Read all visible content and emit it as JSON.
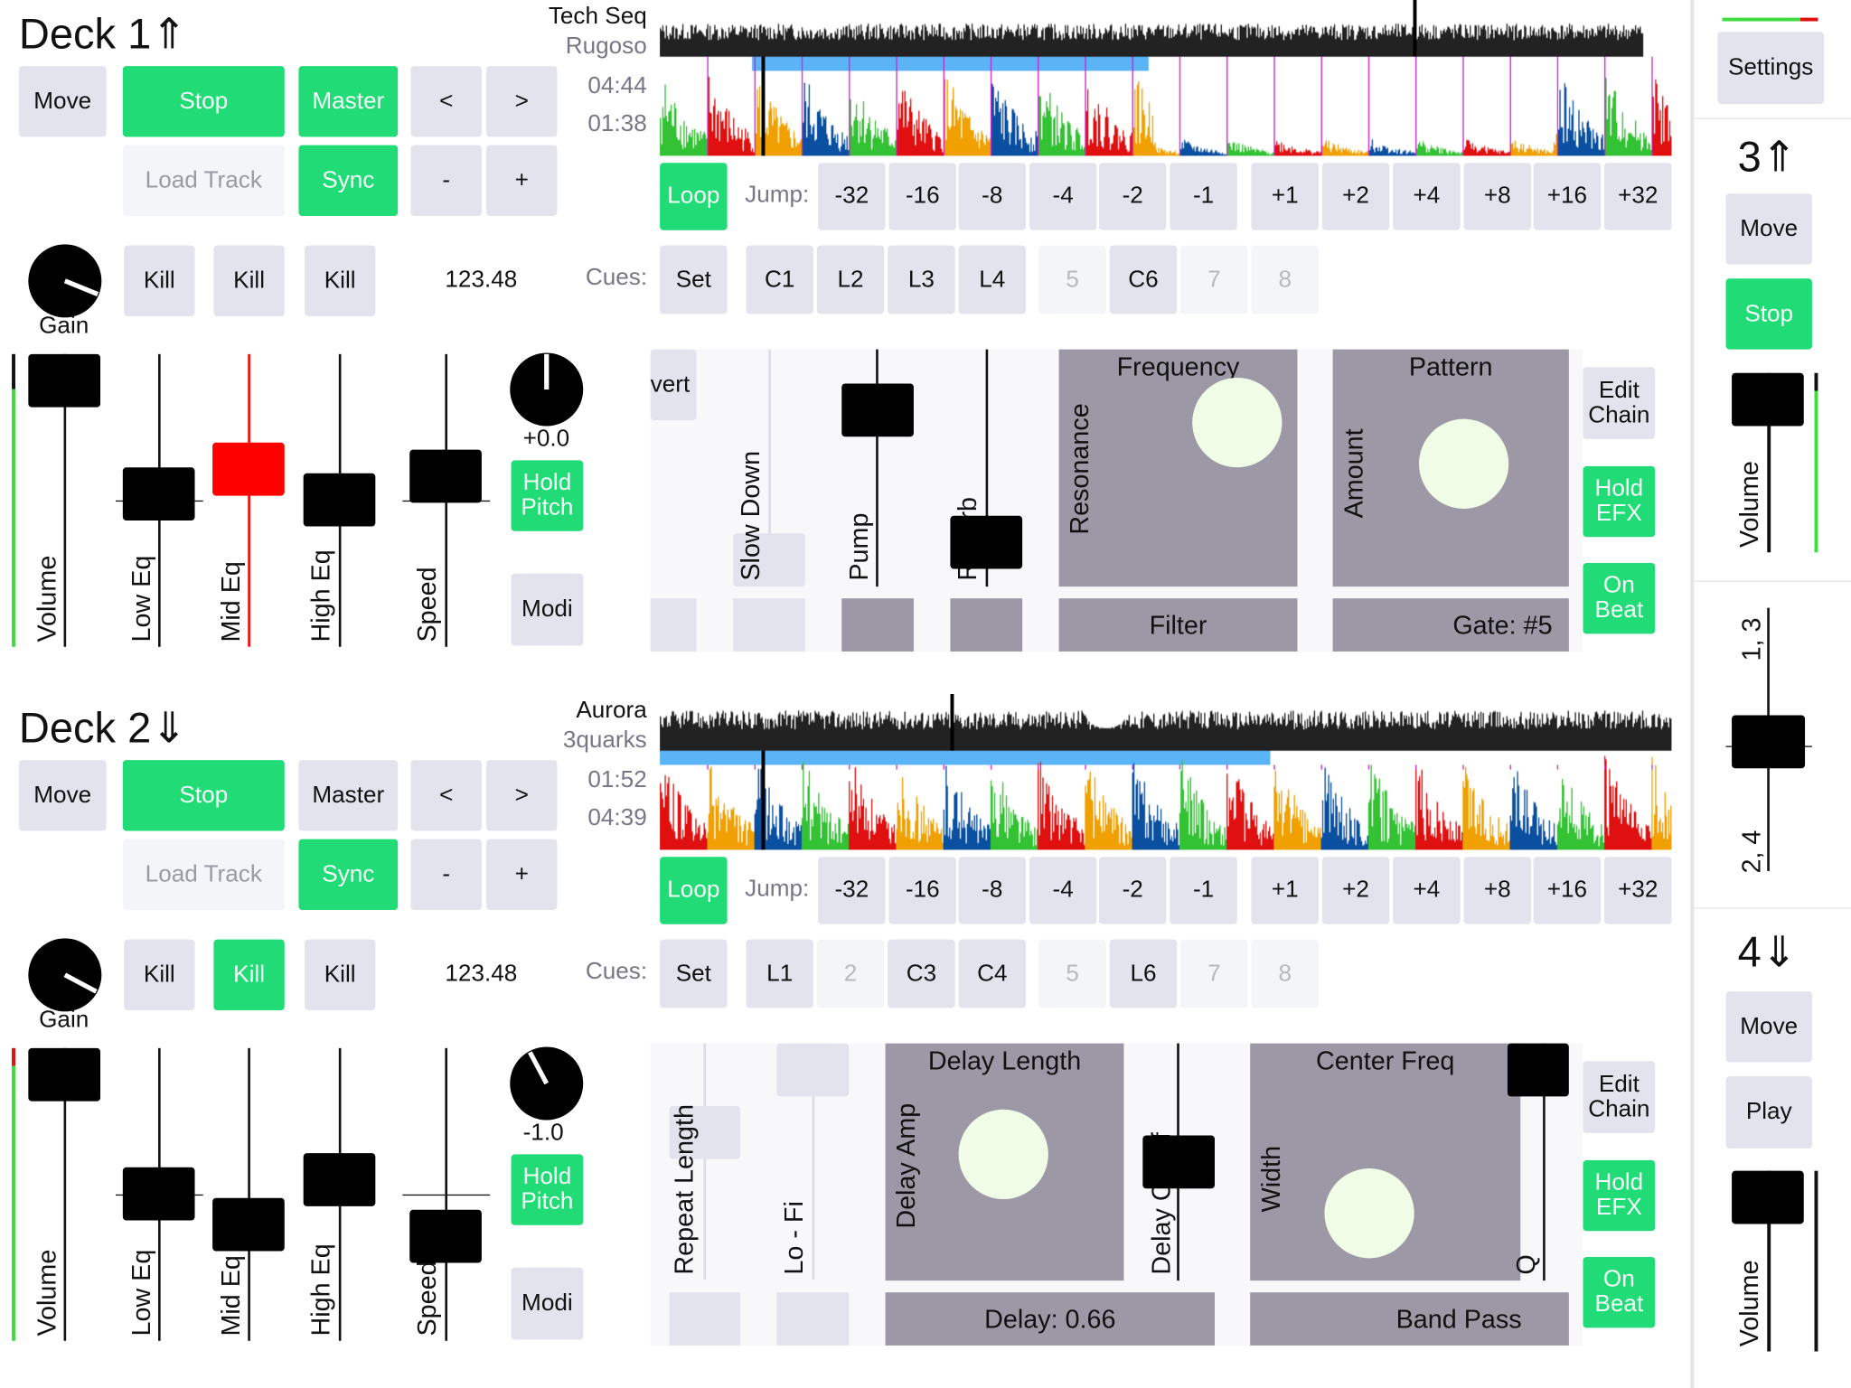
{
  "colors": {
    "accent_green": "#21dc76",
    "button": "#e3e3ee",
    "pad": "#9c98a6",
    "mid_eq_active": "#ff0000",
    "waveform": [
      "#33c233",
      "#e01010",
      "#f0a000",
      "#0a4fa0"
    ],
    "beat_marker": "#d020d0",
    "loop_region": "#5ab4f5"
  },
  "decks": [
    {
      "title": "Deck 1",
      "arrow": "⇑",
      "move": "Move",
      "stop": "Stop",
      "master": "Master",
      "master_active": true,
      "prev": "<",
      "next": ">",
      "load": "Load Track",
      "sync": "Sync",
      "minus": "-",
      "plus": "+",
      "track_title": "Tech Seq",
      "artist": "Rugoso",
      "time_total": "04:44",
      "time_left": "01:38",
      "loop": "Loop",
      "jump_label": "Jump:",
      "jumps": [
        "-32",
        "-16",
        "-8",
        "-4",
        "-2",
        "-1",
        "+1",
        "+2",
        "+4",
        "+8",
        "+16",
        "+32"
      ],
      "gain": "Gain",
      "kills": [
        {
          "label": "Kill",
          "active": false
        },
        {
          "label": "Kill",
          "active": false
        },
        {
          "label": "Kill",
          "active": false
        }
      ],
      "bpm": "123.48",
      "cues_label": "Cues:",
      "cues": [
        {
          "label": "Set",
          "enabled": true
        },
        {
          "label": "C1",
          "enabled": true
        },
        {
          "label": "L2",
          "enabled": true
        },
        {
          "label": "L3",
          "enabled": true
        },
        {
          "label": "L4",
          "enabled": true
        },
        {
          "label": "5",
          "enabled": false
        },
        {
          "label": "C6",
          "enabled": true
        },
        {
          "label": "7",
          "enabled": false
        },
        {
          "label": "8",
          "enabled": false
        }
      ],
      "sliders": {
        "volume": "Volume",
        "low_eq": "Low Eq",
        "mid_eq": "Mid Eq",
        "high_eq": "High Eq",
        "speed": "Speed"
      },
      "pitch_value": "+0.0",
      "hold_pitch": "Hold Pitch",
      "modi": "Modi",
      "fx": {
        "edit_chain": "Edit Chain",
        "hold_efx": "Hold EFX",
        "on_beat": "On Beat",
        "vert": "vert",
        "slow_down": "Slow Down",
        "pump": "Pump",
        "reverb": "Reverb",
        "pad1_x": "Frequency",
        "pad1_y": "Resonance",
        "pad1_button": "Filter",
        "pad2_x": "Pattern",
        "pad2_y": "Amount",
        "pad2_button": "Gate: #5"
      }
    },
    {
      "title": "Deck 2",
      "arrow": "⇓",
      "move": "Move",
      "stop": "Stop",
      "master": "Master",
      "master_active": false,
      "prev": "<",
      "next": ">",
      "load": "Load Track",
      "sync": "Sync",
      "minus": "-",
      "plus": "+",
      "track_title": "Aurora",
      "artist": "3quarks",
      "time_total": "01:52",
      "time_left": "04:39",
      "loop": "Loop",
      "jump_label": "Jump:",
      "jumps": [
        "-32",
        "-16",
        "-8",
        "-4",
        "-2",
        "-1",
        "+1",
        "+2",
        "+4",
        "+8",
        "+16",
        "+32"
      ],
      "gain": "Gain",
      "kills": [
        {
          "label": "Kill",
          "active": false
        },
        {
          "label": "Kill",
          "active": true
        },
        {
          "label": "Kill",
          "active": false
        }
      ],
      "bpm": "123.48",
      "cues_label": "Cues:",
      "cues": [
        {
          "label": "Set",
          "enabled": true
        },
        {
          "label": "L1",
          "enabled": true
        },
        {
          "label": "2",
          "enabled": false
        },
        {
          "label": "C3",
          "enabled": true
        },
        {
          "label": "C4",
          "enabled": true
        },
        {
          "label": "5",
          "enabled": false
        },
        {
          "label": "L6",
          "enabled": true
        },
        {
          "label": "7",
          "enabled": false
        },
        {
          "label": "8",
          "enabled": false
        }
      ],
      "sliders": {
        "volume": "Volume",
        "low_eq": "Low Eq",
        "mid_eq": "Mid Eq",
        "high_eq": "High Eq",
        "speed": "Speed"
      },
      "pitch_value": "-1.0",
      "hold_pitch": "Hold Pitch",
      "modi": "Modi",
      "fx": {
        "edit_chain": "Edit Chain",
        "hold_efx": "Hold EFX",
        "on_beat": "On Beat",
        "repeat_length": "Repeat Length",
        "lo_fi": "Lo - Fi",
        "delay_cutoff": "Delay Cutoff",
        "q": "Q",
        "pad1_x": "Delay Length",
        "pad1_y": "Delay Amp",
        "pad1_button": "Delay: 0.66",
        "pad2_x": "Center Freq",
        "pad2_y": "Width",
        "pad2_button": "Band Pass"
      }
    }
  ],
  "side": {
    "settings": "Settings",
    "deck3": {
      "title": "3",
      "arrow": "⇑",
      "move": "Move",
      "stop": "Stop",
      "volume": "Volume"
    },
    "crossfader": {
      "top": "1, 3",
      "bottom": "2, 4"
    },
    "deck4": {
      "title": "4",
      "arrow": "⇓",
      "move": "Move",
      "play": "Play",
      "volume": "Volume"
    }
  }
}
